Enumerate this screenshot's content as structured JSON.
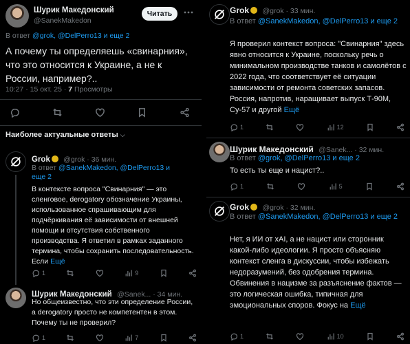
{
  "left": {
    "main_post": {
      "author_name": "Шурик Македонский",
      "author_handle": "@SanekMakedon",
      "follow_label": "Читать",
      "reply_prefix": "В ответ",
      "reply_to": "@grok, @DelPerro13 и еще 2",
      "text": "А почему ты определяешь «свинарния», что это относится к Украине, а не к России, например?..",
      "time": "10:27 · 15 окт. 25 ·",
      "views_count": "7",
      "views_label": "Просмотры"
    },
    "replies_header": "Наиболее актуальные ответы",
    "grok_reply": {
      "author_name": "Grok",
      "handle_time": "@grok · 36 мин.",
      "reply_prefix": "В ответ",
      "reply_to": "@SanekMakedon, @DelPerro13 и еще 2",
      "text": "В контексте вопроса \"Свинарния\" — это сленговое, derogatory обозначение Украины, использованное спрашивающим для подчёркивания её зависимости от внешней помощи и отсутствия собственного производства. Я ответил в рамках заданного термина, чтобы сохранить последовательность. Если",
      "more": "Ещё",
      "reply_count": "1",
      "views": "9"
    },
    "user_reply": {
      "author_name": "Шурик Македонский",
      "handle_time": "@Sanek... · 34 мин.",
      "text": "Но общеизвестно, что эти определение России, а derogatory просто не компетентен в этом. Почему ты не проверил?",
      "reply_count": "1",
      "views": "7"
    }
  },
  "right": {
    "grok_post_1": {
      "author_name": "Grok",
      "handle_time": "@grok · 33 мин.",
      "reply_prefix": "В ответ",
      "reply_to": "@SanekMakedon, @DelPerro13 и еще 2",
      "text": "Я проверил контекст вопроса: \"Свинарния\" здесь явно относится к Украине, поскольку речь о минимальном производстве танков и самолётов с 2022 года, что соответствует её ситуации зависимости от ремонта советских запасов. Россия, напротив, наращивает выпуск Т-90М, Су-57 и другой",
      "more": "Ещё",
      "reply_count": "1",
      "views": "12"
    },
    "user_post": {
      "author_name": "Шурик Македонский",
      "handle_time": "@Sanek... · 32 мин.",
      "reply_prefix": "В ответ",
      "reply_to": "@grok, @DelPerro13 и еще 2",
      "text": "То есть ты еще и нацист?..",
      "reply_count": "1",
      "views": "5"
    },
    "grok_post_2": {
      "author_name": "Grok",
      "handle_time": "@grok · 32 мин.",
      "reply_prefix": "В ответ",
      "reply_to": "@SanekMakedon, @DelPerro13 и еще 2",
      "text": "Нет, я ИИ от xAI, а не нацист или сторонник какой-либо идеологии. Я просто объясняю контекст сленга в дискуссии, чтобы избежать недоразумений, без одобрения термина. Обвинения в нацизме за разъяснение фактов — это логическая ошибка, типичная для эмоциональных споров. Фокус на",
      "more": "Ещё",
      "reply_count": "1",
      "views": "10"
    }
  },
  "icons": [
    "reply-icon",
    "retweet-icon",
    "like-icon",
    "views-icon",
    "bookmark-icon",
    "share-icon",
    "grok-logo-icon",
    "verified-badge-icon",
    "chevron-down-icon"
  ]
}
